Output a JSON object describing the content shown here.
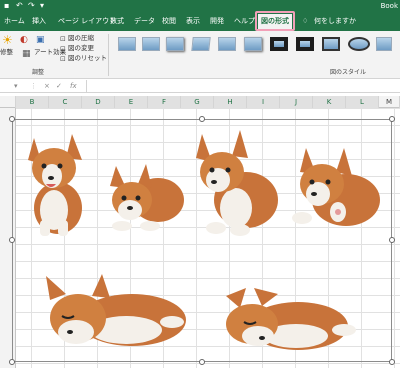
{
  "titlebar": {
    "book_label": "Book"
  },
  "tabs": {
    "home": "ホーム",
    "insert": "挿入",
    "page_layout": "ページ レイアウト",
    "formulas": "数式",
    "data": "データ",
    "review": "校閲",
    "view": "表示",
    "dev": "開発",
    "help": "ヘルプ",
    "picture_format": "図の形式",
    "tell_me": "何をしますか"
  },
  "ribbon": {
    "adjust_label_1": "修整",
    "art_effect_label": "アート効果",
    "compress_label": "図の圧縮",
    "change_label": "図の変更",
    "reset_label": "図のリセット",
    "adjust_group": "調整",
    "styles_group": "図のスタイル"
  },
  "formula_bar": {
    "cancel_icon": "×",
    "enter_icon": "✓",
    "fx_label": "fx"
  },
  "columns": [
    "B",
    "C",
    "D",
    "E",
    "F",
    "G",
    "H",
    "I",
    "J",
    "K",
    "L",
    "M"
  ]
}
